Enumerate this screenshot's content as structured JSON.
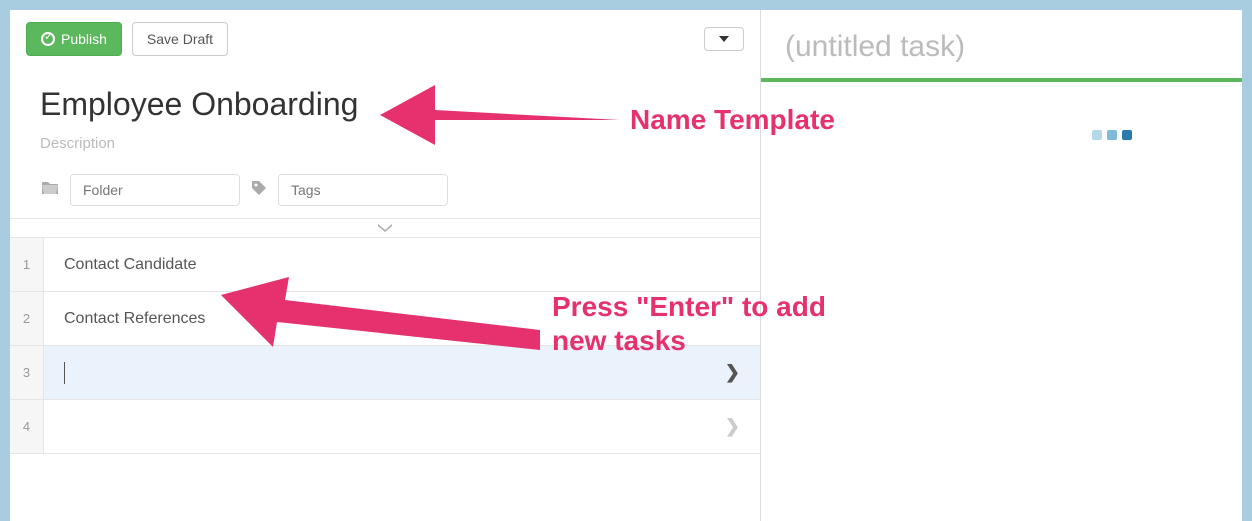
{
  "toolbar": {
    "publish_label": "Publish",
    "save_draft_label": "Save Draft"
  },
  "template": {
    "title": "Employee Onboarding",
    "description_placeholder": "Description"
  },
  "meta": {
    "folder_placeholder": "Folder",
    "tags_placeholder": "Tags"
  },
  "tasks": [
    {
      "num": "1",
      "label": "Contact Candidate",
      "active": false,
      "arrow": false
    },
    {
      "num": "2",
      "label": "Contact References",
      "active": false,
      "arrow": false
    },
    {
      "num": "3",
      "label": "",
      "active": true,
      "arrow": true
    },
    {
      "num": "4",
      "label": "",
      "active": false,
      "arrow": true
    }
  ],
  "right_panel": {
    "title_placeholder": "(untitled task)"
  },
  "annotations": {
    "name_template": "Name Template",
    "press_enter": "Press \"Enter\" to add new tasks"
  }
}
